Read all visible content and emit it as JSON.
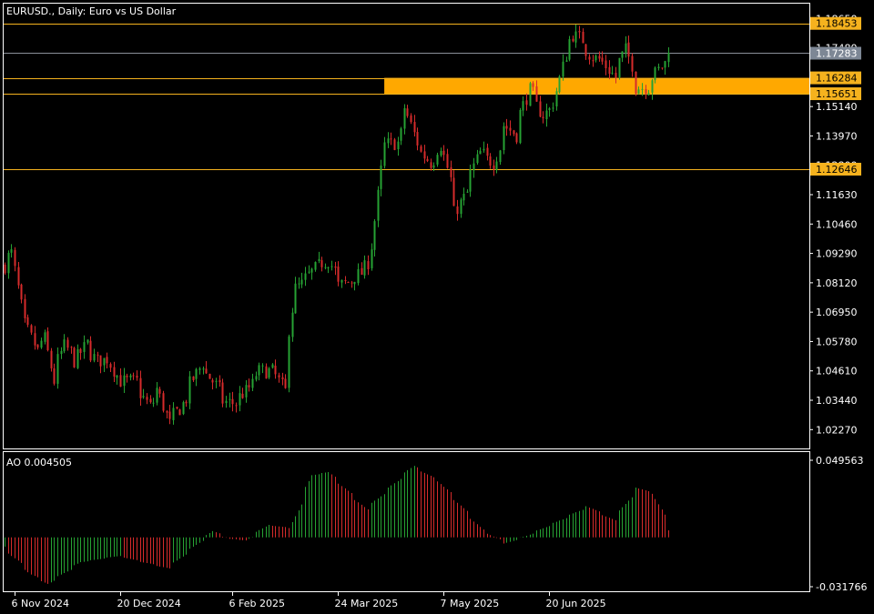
{
  "window": {
    "title": "EURUSD., Daily:  Euro vs US Dollar"
  },
  "colors": {
    "background": "#000000",
    "frame": "#ffffff",
    "bull": "#26a233",
    "bear": "#d62b2b",
    "level_line": "#f5b21e",
    "zone_fill": "#ffa800",
    "current_price_bg": "#7d8795",
    "current_price_line": "#8a8f99",
    "price_label_bg": "#f5b21e"
  },
  "price_axis": {
    "ticks": [
      "1.18650",
      "1.17480",
      "1.16310",
      "1.15140",
      "1.13970",
      "1.12800",
      "1.11630",
      "1.10460",
      "1.09290",
      "1.08120",
      "1.06950",
      "1.05780",
      "1.04610",
      "1.03440",
      "1.02270"
    ],
    "level_labels": [
      "1.18453",
      "1.16284",
      "1.15651",
      "1.12646"
    ],
    "current_price": "1.17283",
    "ymin": 1.0152,
    "ymax": 1.1924
  },
  "indicator": {
    "label": "AO 0.004505",
    "max_label": "0.049563",
    "min_label": "-0.031766",
    "ymin": -0.0318,
    "ymax": 0.0496
  },
  "time_axis": {
    "labels": [
      "6 Nov 2024",
      "20 Dec 2024",
      "6 Feb 2025",
      "24 Mar 2025",
      "7 May 2025",
      "20 Jun 2025"
    ]
  },
  "levels": [
    {
      "price": 1.18453,
      "label": "1.18453"
    },
    {
      "price": 1.16284,
      "label": "1.16284"
    },
    {
      "price": 1.15651,
      "label": "1.15651"
    },
    {
      "price": 1.12646,
      "label": "1.12646"
    }
  ],
  "zone": {
    "top": 1.16284,
    "bottom": 1.15651,
    "start_date": "2025-04-11"
  },
  "chart_data": {
    "type": "candlestick",
    "symbol": "EURUSD.",
    "timeframe": "Daily",
    "anchors": [
      [
        "2024-11-01",
        1.088
      ],
      [
        "2024-11-05",
        1.093
      ],
      [
        "2024-11-08",
        1.072
      ],
      [
        "2024-11-12",
        1.062
      ],
      [
        "2024-11-15",
        1.054
      ],
      [
        "2024-11-19",
        1.059
      ],
      [
        "2024-11-22",
        1.042
      ],
      [
        "2024-11-27",
        1.056
      ],
      [
        "2024-12-02",
        1.05
      ],
      [
        "2024-12-06",
        1.057
      ],
      [
        "2024-12-11",
        1.05
      ],
      [
        "2024-12-16",
        1.051
      ],
      [
        "2024-12-20",
        1.042
      ],
      [
        "2024-12-27",
        1.042
      ],
      [
        "2025-01-02",
        1.032
      ],
      [
        "2025-01-06",
        1.039
      ],
      [
        "2025-01-10",
        1.025
      ],
      [
        "2025-01-15",
        1.031
      ],
      [
        "2025-01-20",
        1.041
      ],
      [
        "2025-01-24",
        1.049
      ],
      [
        "2025-01-29",
        1.042
      ],
      [
        "2025-02-03",
        1.034
      ],
      [
        "2025-02-07",
        1.033
      ],
      [
        "2025-02-12",
        1.038
      ],
      [
        "2025-02-18",
        1.046
      ],
      [
        "2025-02-24",
        1.046
      ],
      [
        "2025-02-28",
        1.038
      ],
      [
        "2025-03-05",
        1.079
      ],
      [
        "2025-03-10",
        1.083
      ],
      [
        "2025-03-14",
        1.088
      ],
      [
        "2025-03-19",
        1.09
      ],
      [
        "2025-03-24",
        1.08
      ],
      [
        "2025-03-28",
        1.082
      ],
      [
        "2025-04-02",
        1.085
      ],
      [
        "2025-04-07",
        1.096
      ],
      [
        "2025-04-11",
        1.136
      ],
      [
        "2025-04-17",
        1.137
      ],
      [
        "2025-04-21",
        1.151
      ],
      [
        "2025-04-25",
        1.137
      ],
      [
        "2025-05-01",
        1.129
      ],
      [
        "2025-05-06",
        1.136
      ],
      [
        "2025-05-12",
        1.109
      ],
      [
        "2025-05-16",
        1.117
      ],
      [
        "2025-05-22",
        1.133
      ],
      [
        "2025-05-28",
        1.129
      ],
      [
        "2025-06-02",
        1.144
      ],
      [
        "2025-06-06",
        1.14
      ],
      [
        "2025-06-12",
        1.158
      ],
      [
        "2025-06-18",
        1.148
      ],
      [
        "2025-06-23",
        1.153
      ],
      [
        "2025-06-27",
        1.172
      ],
      [
        "2025-07-01",
        1.18
      ],
      [
        "2025-07-04",
        1.178
      ],
      [
        "2025-07-09",
        1.171
      ],
      [
        "2025-07-14",
        1.169
      ],
      [
        "2025-07-18",
        1.163
      ],
      [
        "2025-07-23",
        1.174
      ],
      [
        "2025-07-28",
        1.159
      ],
      [
        "2025-08-01",
        1.159
      ],
      [
        "2025-08-06",
        1.166
      ],
      [
        "2025-08-11",
        1.173
      ]
    ],
    "last_close": 1.17283,
    "ao_anchors": [
      [
        "2024-11-01",
        -0.006
      ],
      [
        "2024-11-13",
        -0.024
      ],
      [
        "2024-11-20",
        -0.03
      ],
      [
        "2024-12-04",
        -0.016
      ],
      [
        "2024-12-20",
        -0.012
      ],
      [
        "2025-01-10",
        -0.02
      ],
      [
        "2025-01-29",
        0.004
      ],
      [
        "2025-02-05",
        -0.001
      ],
      [
        "2025-02-12",
        -0.002
      ],
      [
        "2025-02-21",
        0.008
      ],
      [
        "2025-03-03",
        0.006
      ],
      [
        "2025-03-12",
        0.04
      ],
      [
        "2025-03-19",
        0.042
      ],
      [
        "2025-04-04",
        0.018
      ],
      [
        "2025-04-24",
        0.046
      ],
      [
        "2025-05-05",
        0.036
      ],
      [
        "2025-05-23",
        0.005
      ],
      [
        "2025-06-02",
        -0.004
      ],
      [
        "2025-06-11",
        0.001
      ],
      [
        "2025-06-24",
        0.01
      ],
      [
        "2025-07-07",
        0.02
      ],
      [
        "2025-07-18",
        0.011
      ],
      [
        "2025-07-28",
        0.032
      ],
      [
        "2025-08-04",
        0.028
      ],
      [
        "2025-08-11",
        0.004505
      ]
    ]
  }
}
